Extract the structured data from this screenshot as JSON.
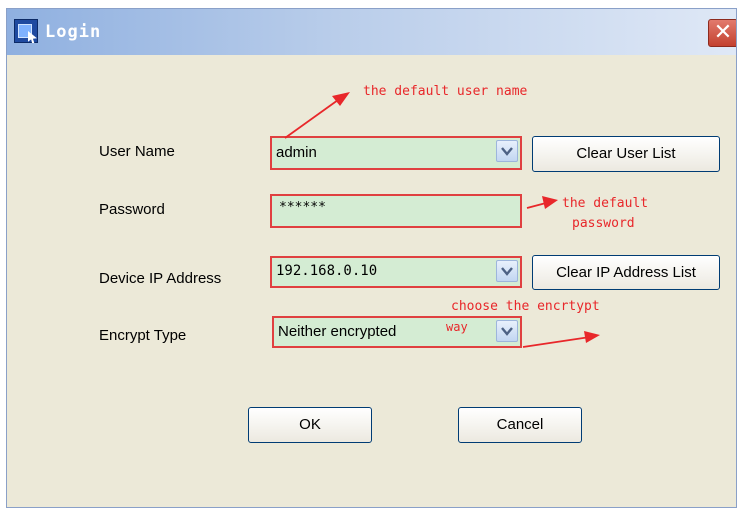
{
  "window": {
    "title": "Login"
  },
  "fields": {
    "user_name": {
      "label": "User Name",
      "value": "admin"
    },
    "password": {
      "label": "Password",
      "value": "******"
    },
    "device_ip": {
      "label": "Device IP Address",
      "value": "192.168.0.10"
    },
    "encrypt_type": {
      "label": "Encrypt Type",
      "value": "Neither encrypted"
    }
  },
  "buttons": {
    "clear_user_list": "Clear User List",
    "clear_ip_list": "Clear IP Address List",
    "ok": "OK",
    "cancel": "Cancel"
  },
  "annotations": {
    "default_user": "the default user name",
    "default_password_1": "the default",
    "default_password_2": "password",
    "encrypt_way_1": "choose the encrtypt",
    "encrypt_way_2": "way"
  },
  "colors": {
    "annotation": "#e8272a",
    "field_bg": "#d4ecd3",
    "window_bg": "#ece9d8"
  }
}
